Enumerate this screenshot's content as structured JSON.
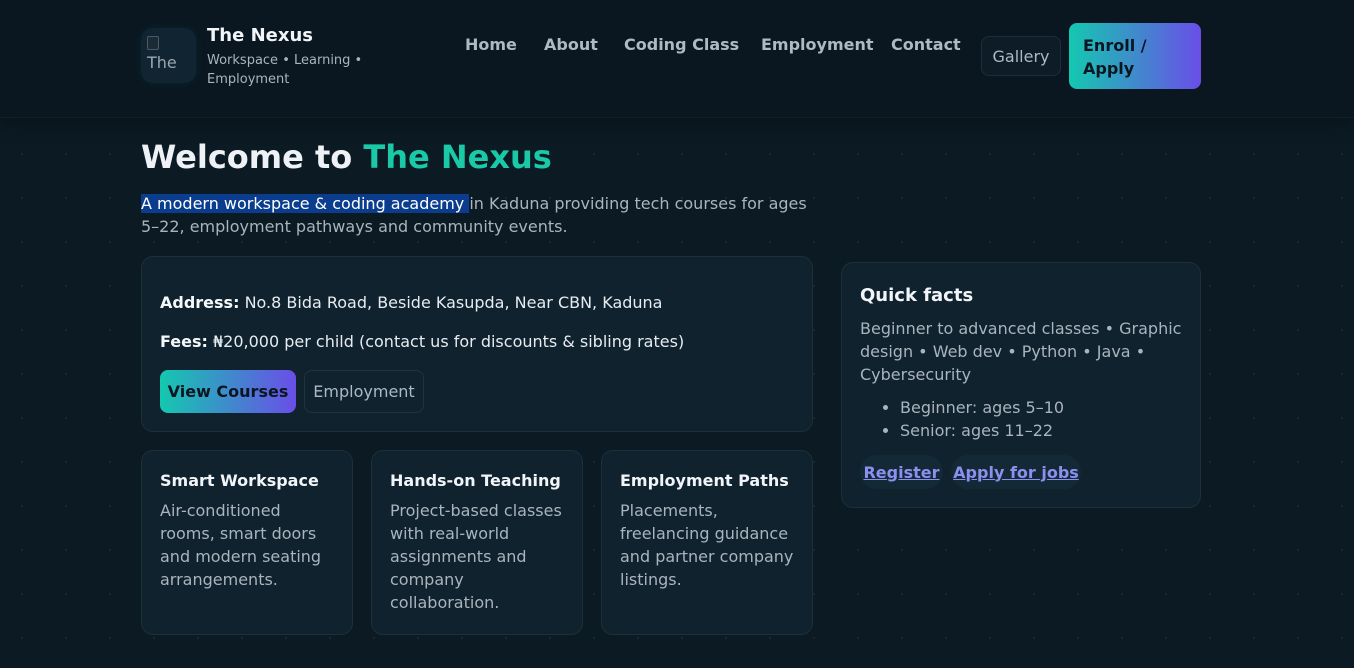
{
  "header": {
    "logo_alt": "The",
    "brand_name": "The Nexus",
    "brand_tagline": "Workspace • Learning • Employment",
    "nav": [
      {
        "label": "Home"
      },
      {
        "label": "About"
      },
      {
        "label": "Coding Class"
      },
      {
        "label": "Employment"
      },
      {
        "label": "Contact"
      }
    ],
    "gallery_label": "Gallery",
    "enroll_label": "Enroll / Apply"
  },
  "hero": {
    "title_prefix": "Welcome to ",
    "title_accent": "The Nexus",
    "desc_selected": "A modern workspace & coding academy ",
    "desc_rest": "in Kaduna providing tech courses for ages 5–22, employment pathways and community events."
  },
  "info": {
    "address_label": "Address:",
    "address_value": " No.8 Bida Road, Beside Kasupda, Near CBN, Kaduna",
    "fees_label": "Fees:",
    "fees_value": " ₦20,000 per child (contact us for discounts & sibling rates)",
    "view_courses_label": "View Courses",
    "employment_label": "Employment"
  },
  "facts": {
    "title": "Quick facts",
    "desc": "Beginner to advanced classes • Graphic design • Web dev • Python • Java • Cybersecurity",
    "items": [
      "Beginner: ages 5–10",
      "Senior: ages 11–22"
    ],
    "register_label": "Register",
    "apply_label": "Apply for jobs"
  },
  "features": [
    {
      "title": "Smart Workspace",
      "text": "Air-conditioned rooms, smart doors and modern seating arrangements."
    },
    {
      "title": "Hands-on Teaching",
      "text": "Project-based classes with real-world assignments and company collaboration."
    },
    {
      "title": "Employment Paths",
      "text": "Placements, freelancing guidance and partner company listings."
    }
  ],
  "colors": {
    "background": "#0b1a23",
    "accent": "#19c9a8",
    "gradient_start": "#14c8b0",
    "gradient_end": "#6a4ee8",
    "link": "#8b8ff0"
  }
}
